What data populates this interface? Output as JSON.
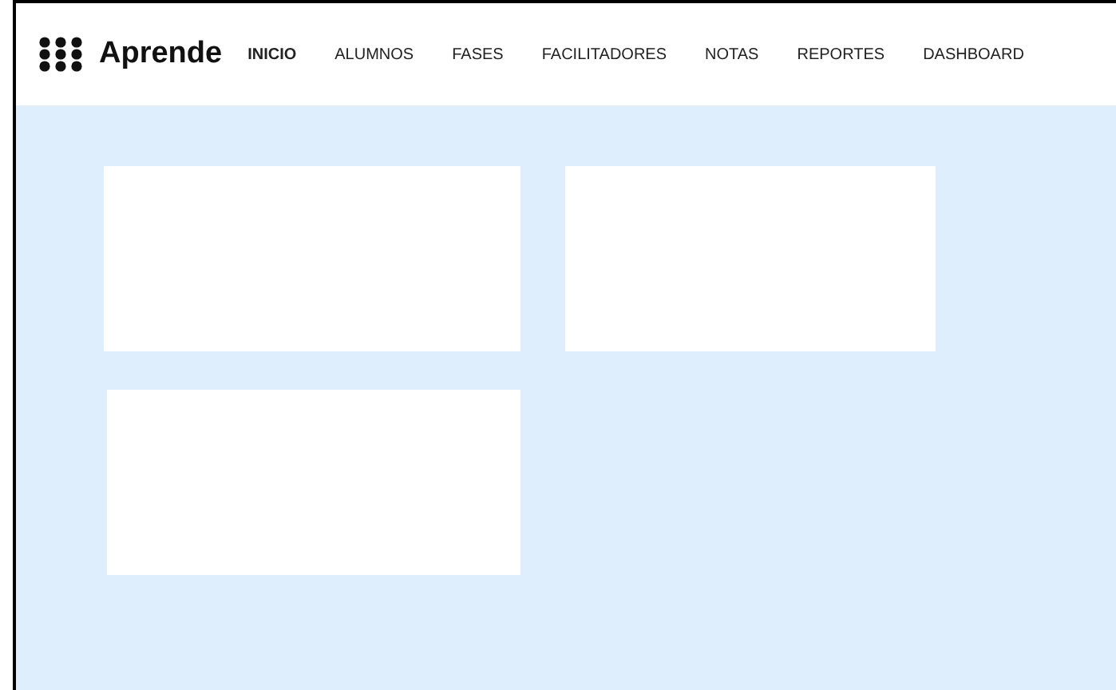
{
  "navbar": {
    "brand": "Aprende",
    "items": [
      {
        "label": "INICIO",
        "selected": true
      },
      {
        "label": "ALUMNOS",
        "selected": false
      },
      {
        "label": "FASES",
        "selected": false
      },
      {
        "label": "FACILITADORES",
        "selected": false
      },
      {
        "label": "NOTAS",
        "selected": false
      },
      {
        "label": "REPORTES",
        "selected": false
      },
      {
        "label": "DASHBOARD",
        "selected": false
      }
    ]
  }
}
